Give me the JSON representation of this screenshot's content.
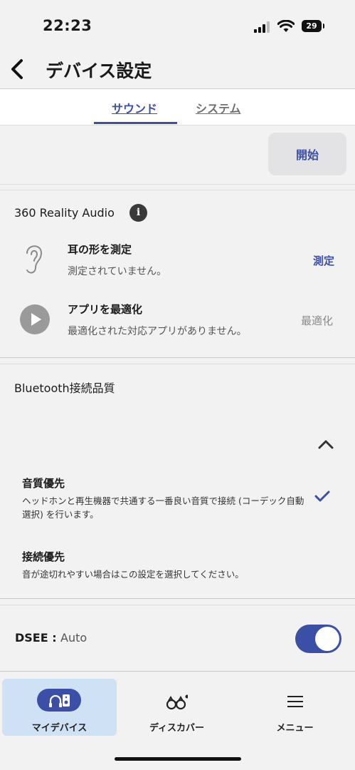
{
  "status": {
    "time": "22:23",
    "battery": "29"
  },
  "nav": {
    "title": "デバイス設定"
  },
  "tabs": [
    {
      "label": "サウンド"
    },
    {
      "label": "システム"
    }
  ],
  "start": {
    "label": "開始"
  },
  "reality": {
    "title": "360 Reality Audio",
    "ear": {
      "title": "耳の形を測定",
      "desc": "測定されていません。",
      "action": "測定"
    },
    "app": {
      "title": "アプリを最適化",
      "desc": "最適化された対応アプリがありません。",
      "action": "最適化"
    }
  },
  "bluetooth": {
    "title": "Bluetooth接続品質",
    "options": [
      {
        "title": "音質優先",
        "desc": "ヘッドホンと再生機器で共通する一番良い音質で接続 (コーデック自動選択) を行います。"
      },
      {
        "title": "接続優先",
        "desc": "音が途切れやすい場合はこの設定を選択してください。"
      }
    ]
  },
  "dsee": {
    "label": "DSEE :",
    "value": "Auto"
  },
  "tabbar": [
    {
      "label": "マイデバイス"
    },
    {
      "label": "ディスカバー"
    },
    {
      "label": "メニュー"
    }
  ],
  "colors": {
    "accent": "#3c4fa6",
    "selected_tab_bg": "#cfe2f5"
  }
}
